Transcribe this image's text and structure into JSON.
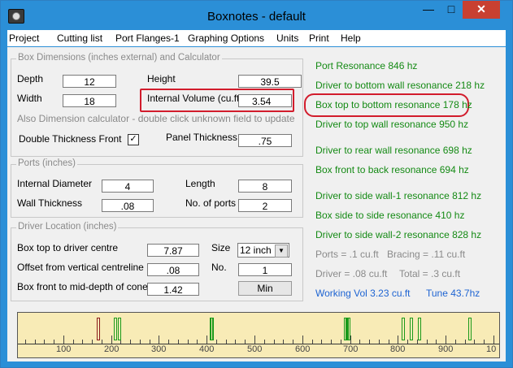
{
  "window": {
    "title": "Boxnotes - default",
    "minimize": "—",
    "maximize": "□",
    "close": "✕"
  },
  "menu": [
    "Project",
    "Cutting list",
    "Port Flanges-1",
    "Graphing Options",
    "Units",
    "Print",
    "Help"
  ],
  "box_dimensions": {
    "title": "Box Dimensions (inches external) and Calculator",
    "depth_label": "Depth",
    "depth": "12",
    "height_label": "Height",
    "height": "39.5",
    "width_label": "Width",
    "width": "18",
    "internal_volume_label": "Internal Volume (cu.ft)",
    "internal_volume": "3.54",
    "calc_hint": "Also Dimension calculator - double click unknown field to update",
    "double_thickness_label": "Double Thickness Front",
    "double_thickness_checked": "✓",
    "panel_thickness_label": "Panel Thickness",
    "panel_thickness": ".75"
  },
  "ports": {
    "title": "Ports (inches)",
    "internal_diameter_label": "Internal Diameter",
    "internal_diameter": "4",
    "length_label": "Length",
    "length": "8",
    "wall_thickness_label": "Wall Thickness",
    "wall_thickness": ".08",
    "num_ports_label": "No. of ports",
    "num_ports": "2"
  },
  "driver_location": {
    "title": "Driver Location (inches)",
    "top_to_centre_label": "Box top to driver centre",
    "top_to_centre": "7.87",
    "size_label": "Size",
    "size": "12 inch",
    "offset_label": "Offset from vertical centreline",
    "offset": ".08",
    "no_label": "No.",
    "no": "1",
    "front_depth_label": "Box front to mid-depth of cone",
    "front_depth": "1.42",
    "min_button": "Min"
  },
  "results": {
    "port_resonance": "Port Resonance  846 hz",
    "driver_bottom": "Driver to bottom wall resonance  218 hz",
    "box_top_bottom": "Box top to bottom resonance  178 hz",
    "driver_top": "Driver to top wall resonance  950 hz",
    "driver_rear": "Driver to rear wall resonance 698 hz",
    "box_front_back": "Box front to back resonance  694 hz",
    "driver_side1": "Driver to side wall-1 resonance  812 hz",
    "box_side_side": "Box side to side resonance  410 hz",
    "driver_side2": "Driver to side wall-2 resonance  828 hz",
    "ports_vol": "Ports = .1 cu.ft",
    "bracing_vol": "Bracing = .11 cu.ft",
    "driver_vol": "Driver =  .08 cu.ft",
    "total_vol": "Total =  .3 cu.ft",
    "working_vol": "Working Vol  3.23 cu.ft",
    "tune": "Tune  43.7hz"
  },
  "graph": {
    "tick_labels": [
      "100",
      "200",
      "300",
      "400",
      "500",
      "600",
      "700",
      "800",
      "900",
      "10"
    ],
    "marks_hz": [
      174,
      210,
      218,
      410,
      412,
      690,
      694,
      698,
      812,
      828,
      846,
      950
    ],
    "highlight_hz": [
      174
    ],
    "colors": {
      "normal": "#1a9a1a",
      "highlight": "#8b1a1a",
      "background": "#f8ebb6"
    }
  }
}
